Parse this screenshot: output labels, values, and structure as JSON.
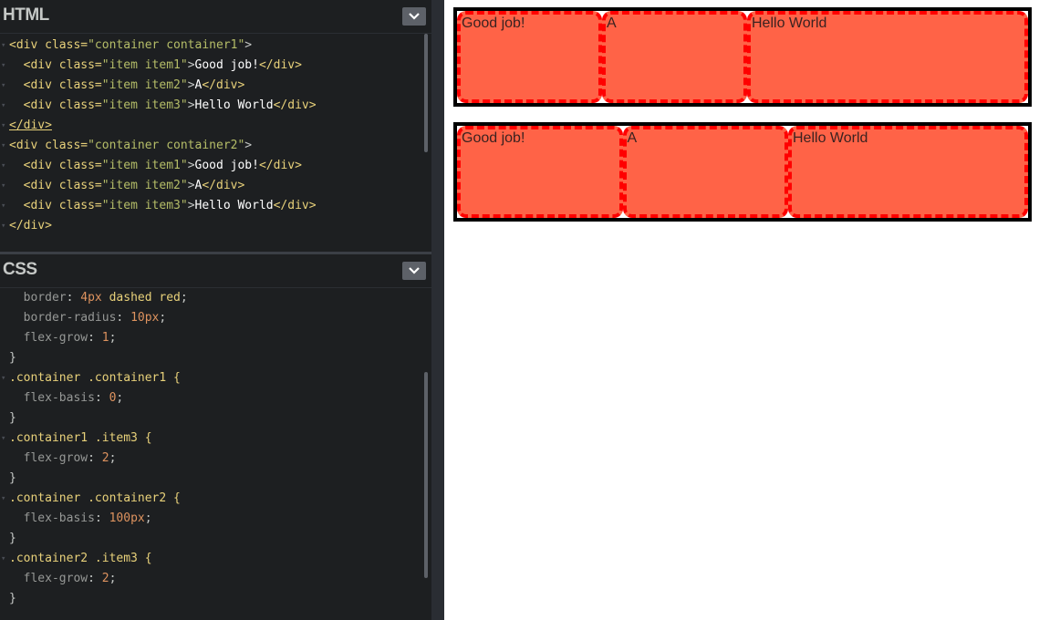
{
  "html_panel": {
    "title": "HTML",
    "lines": [
      [
        "<div ",
        "class=",
        "\"container container1\"",
        ">"
      ],
      [
        "  <div ",
        "class=",
        "\"item item1\"",
        ">",
        "Good job!",
        "</div>"
      ],
      [
        "  <div ",
        "class=",
        "\"item item2\"",
        ">",
        "A",
        "</div>"
      ],
      [
        "  <div ",
        "class=",
        "\"item item3\"",
        ">",
        "Hello World",
        "</div>"
      ],
      [
        "</div>"
      ],
      [
        "<div ",
        "class=",
        "\"container container2\"",
        ">"
      ],
      [
        "  <div ",
        "class=",
        "\"item item1\"",
        ">",
        "Good job!",
        "</div>"
      ],
      [
        "  <div ",
        "class=",
        "\"item item2\"",
        ">",
        "A",
        "</div>"
      ],
      [
        "  <div ",
        "class=",
        "\"item item3\"",
        ">",
        "Hello World",
        "</div>"
      ],
      [
        "</div>"
      ]
    ]
  },
  "css_panel": {
    "title": "CSS",
    "lines": [
      {
        "type": "decl",
        "prop": "border",
        "val": "4px dashed red",
        "num": "4px",
        "rest": " dashed red"
      },
      {
        "type": "decl",
        "prop": "border-radius",
        "num": "10px",
        "rest": ""
      },
      {
        "type": "decl",
        "prop": "flex-grow",
        "num": "1",
        "rest": ""
      },
      {
        "type": "close",
        "text": "}"
      },
      {
        "type": "sel",
        "text": ".container .container1 {"
      },
      {
        "type": "decl",
        "prop": "flex-basis",
        "num": "0",
        "rest": ""
      },
      {
        "type": "close",
        "text": "}"
      },
      {
        "type": "sel",
        "text": ".container1 .item3 {"
      },
      {
        "type": "decl",
        "prop": "flex-grow",
        "num": "2",
        "rest": ""
      },
      {
        "type": "close",
        "text": "}"
      },
      {
        "type": "sel",
        "text": ".container .container2 {"
      },
      {
        "type": "decl",
        "prop": "flex-basis",
        "num": "100px",
        "rest": ""
      },
      {
        "type": "close",
        "text": "}"
      },
      {
        "type": "sel",
        "text": ".container2 .item3 {"
      },
      {
        "type": "decl",
        "prop": "flex-grow",
        "num": "2",
        "rest": ""
      },
      {
        "type": "close",
        "text": "}"
      }
    ]
  },
  "preview": {
    "container1": {
      "item1": "Good job!",
      "item2": "A",
      "item3": "Hello World"
    },
    "container2": {
      "item1": "Good job!",
      "item2": "A",
      "item3": "Hello World"
    }
  },
  "colors": {
    "editor_bg": "#1d1f21",
    "item_bg": "#ff6347",
    "item_border": "red",
    "container_border": "#000000"
  },
  "icons": {
    "collapse": "chevron-down-icon"
  }
}
